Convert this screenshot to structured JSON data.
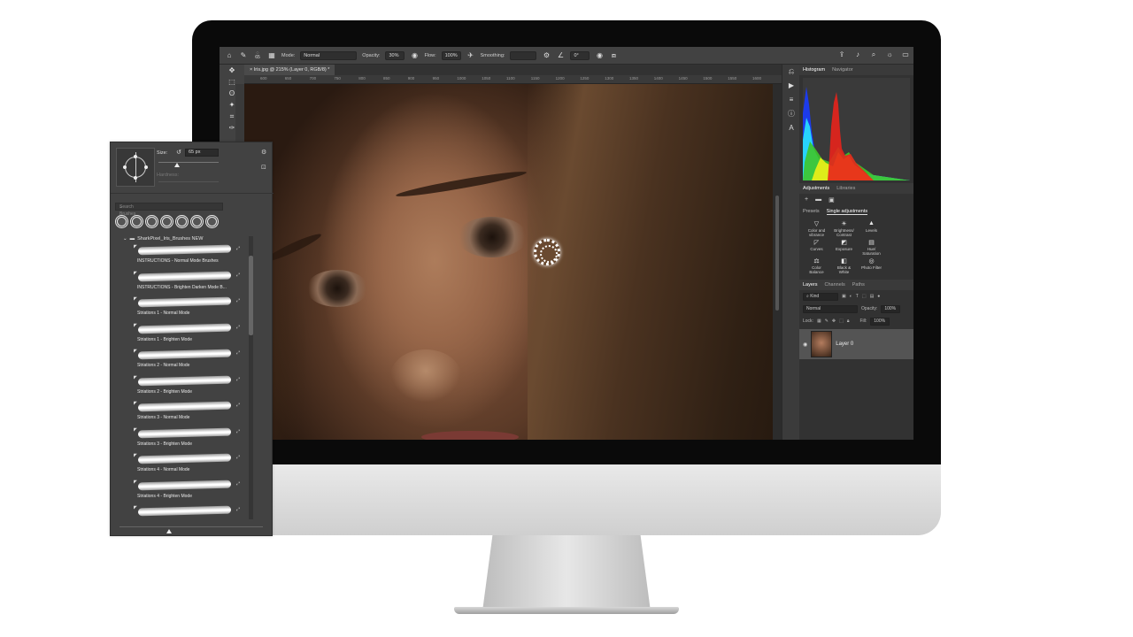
{
  "options_bar": {
    "brush_size": "65",
    "mode_label": "Mode:",
    "mode_value": "Normal",
    "opacity_label": "Opacity:",
    "opacity_value": "30%",
    "flow_label": "Flow:",
    "flow_value": "100%",
    "smoothing_label": "Smoothing:",
    "angle_value": "0°"
  },
  "document_tab": "Iris.jpg @ 215% (Layer 0, RGB/8) *",
  "ruler_ticks": [
    "600",
    "650",
    "700",
    "750",
    "800",
    "850",
    "900",
    "950",
    "1000",
    "1050",
    "1100",
    "1150",
    "1200",
    "1250",
    "1300",
    "1350",
    "1400",
    "1450",
    "1500",
    "1550",
    "1600"
  ],
  "histogram_panel": {
    "tabs": [
      "Histogram",
      "Navigator"
    ]
  },
  "adjustments_panel": {
    "tabs": [
      "Adjustments",
      "Libraries"
    ],
    "mode_tabs": [
      "Presets",
      "Single adjustments"
    ],
    "items": [
      {
        "icon": "color-vibrance-icon",
        "label_1": "Color and",
        "label_2": "vibrance"
      },
      {
        "icon": "brightness-contrast-icon",
        "label_1": "Brightness/",
        "label_2": "Contrast"
      },
      {
        "icon": "levels-icon",
        "label_1": "Levels",
        "label_2": ""
      },
      {
        "icon": "curves-icon",
        "label_1": "Curves",
        "label_2": ""
      },
      {
        "icon": "exposure-icon",
        "label_1": "Exposure",
        "label_2": ""
      },
      {
        "icon": "hue-saturation-icon",
        "label_1": "Hue/",
        "label_2": "Saturation"
      },
      {
        "icon": "color-balance-icon",
        "label_1": "Color",
        "label_2": "Balance"
      },
      {
        "icon": "black-white-icon",
        "label_1": "Black &",
        "label_2": "White"
      },
      {
        "icon": "photo-filter-icon",
        "label_1": "Photo Filter",
        "label_2": ""
      }
    ]
  },
  "layers_panel": {
    "tabs": [
      "Layers",
      "Channels",
      "Paths"
    ],
    "filter_kind": "Kind",
    "blend_mode": "Normal",
    "opacity_label": "Opacity:",
    "opacity_value": "100%",
    "lock_label": "Lock:",
    "fill_label": "Fill:",
    "fill_value": "100%",
    "layer_name": "Layer 0"
  },
  "brushes_panel": {
    "size_label": "Size:",
    "size_value": "65 px",
    "hardness_label": "Hardness:",
    "search_placeholder": "Search Brushes",
    "folder_name": "SharkPixel_Iris_Brushes NEW",
    "brushes": [
      "INSTRUCTIONS - Normal Mode Brushes",
      "INSTRUCTIONS - Brighten Darken Mode B...",
      "Striations 1 - Normal Mode",
      "Striations 1 - Brighten Mode",
      "Striations 2 - Normal Mode",
      "Striations 2 - Brighten Mode",
      "Striations 3 - Normal Mode",
      "Striations 3 - Brighten Mode",
      "Striations 4 - Normal Mode",
      "Striations 4 - Brighten Mode",
      ""
    ]
  },
  "colors": {
    "ps_panel": "#323232",
    "ps_toolbar": "#424242",
    "histogram_red": "#e8241c",
    "histogram_green": "#3ec52a",
    "histogram_blue": "#1a3cff",
    "histogram_cyan": "#2ae4ff",
    "histogram_yellow": "#f0f016"
  }
}
